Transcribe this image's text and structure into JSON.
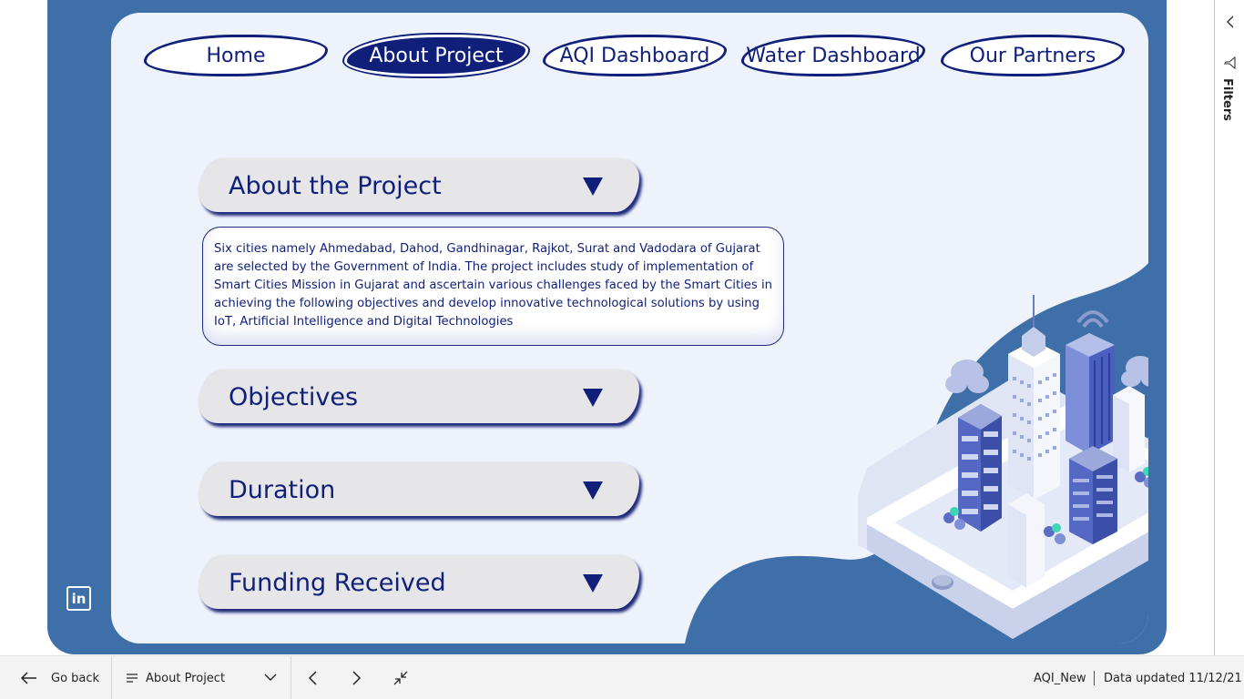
{
  "nav": [
    {
      "label": "Home",
      "active": false
    },
    {
      "label": "About Project",
      "active": true
    },
    {
      "label": "AQI Dashboard",
      "active": false
    },
    {
      "label": "Water Dashboard",
      "active": false
    },
    {
      "label": "Our Partners",
      "active": false
    }
  ],
  "accordion": {
    "about": "About the Project",
    "objectives": "Objectives",
    "duration": "Duration",
    "funding": "Funding Received"
  },
  "description": "Six cities namely Ahmedabad, Dahod, Gandhinagar, Rajkot, Surat and Vadodara of Gujarat are selected by the Government of India. The project includes study of implementation of Smart Cities Mission in Gujarat and ascertain various challenges faced by the Smart Cities in achieving the following objectives and develop innovative technological solutions by using IoT, Artificial Intelligence and Digital Technologies",
  "social": {
    "linkedin_glyph": "in"
  },
  "filters": {
    "label": "Filters"
  },
  "bottombar": {
    "go_back": "Go back",
    "page_selector": "About Project",
    "dataset": "AQI_New",
    "updated": "Data updated 11/12/21"
  },
  "colors": {
    "canvas_blue": "#3f6fa8",
    "navy": "#0f1f7a",
    "panel": "#eef2fb"
  }
}
